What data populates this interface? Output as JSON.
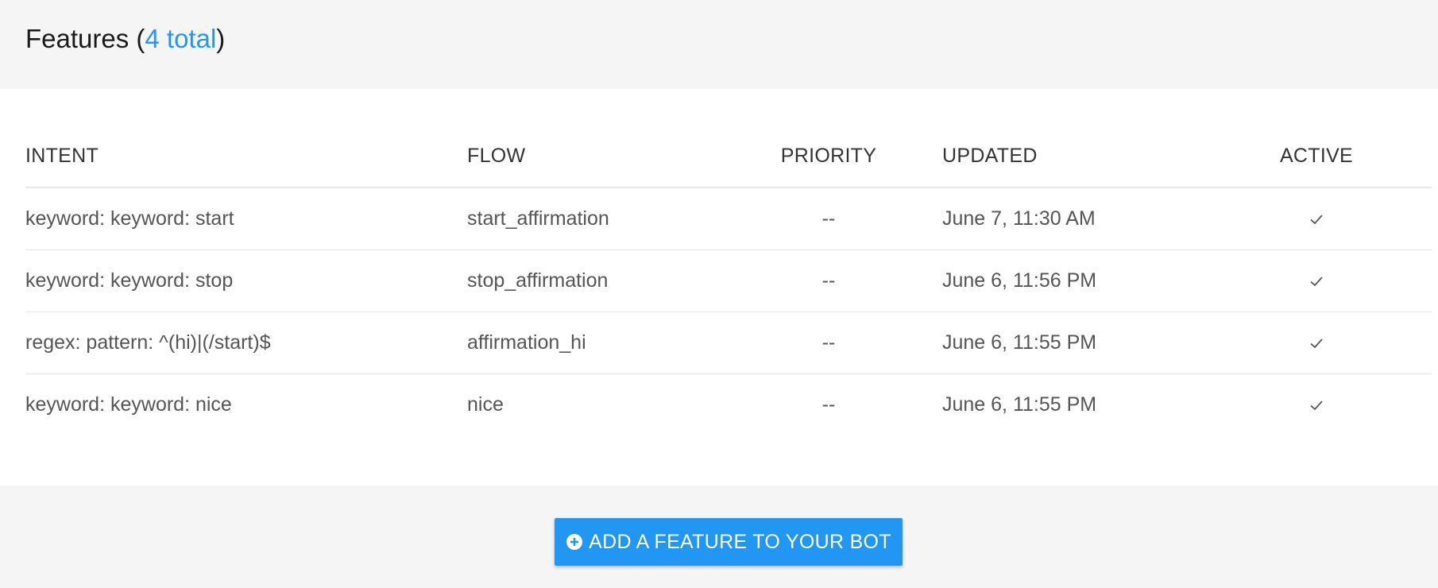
{
  "header": {
    "title": "Features (",
    "total_link": "4 total",
    "title_close": ")"
  },
  "table": {
    "columns": [
      "INTENT",
      "FLOW",
      "PRIORITY",
      "UPDATED",
      "ACTIVE"
    ],
    "rows": [
      {
        "intent": "keyword: keyword: start",
        "flow": "start_affirmation",
        "priority": "--",
        "updated": "June 7, 11:30 AM",
        "active": true
      },
      {
        "intent": "keyword: keyword: stop",
        "flow": "stop_affirmation",
        "priority": "--",
        "updated": "June 6, 11:56 PM",
        "active": true
      },
      {
        "intent": "regex: pattern: ^(hi)|(/start)$",
        "flow": "affirmation_hi",
        "priority": "--",
        "updated": "June 6, 11:55 PM",
        "active": true
      },
      {
        "intent": "keyword: keyword: nice",
        "flow": "nice",
        "priority": "--",
        "updated": "June 6, 11:55 PM",
        "active": true
      }
    ]
  },
  "footer": {
    "add_button_label": "ADD A FEATURE TO YOUR BOT",
    "add_button_icon": "plus-circle-icon"
  },
  "colors": {
    "accent": "#2196f3",
    "background": "#f5f5f5",
    "panel": "#ffffff"
  }
}
